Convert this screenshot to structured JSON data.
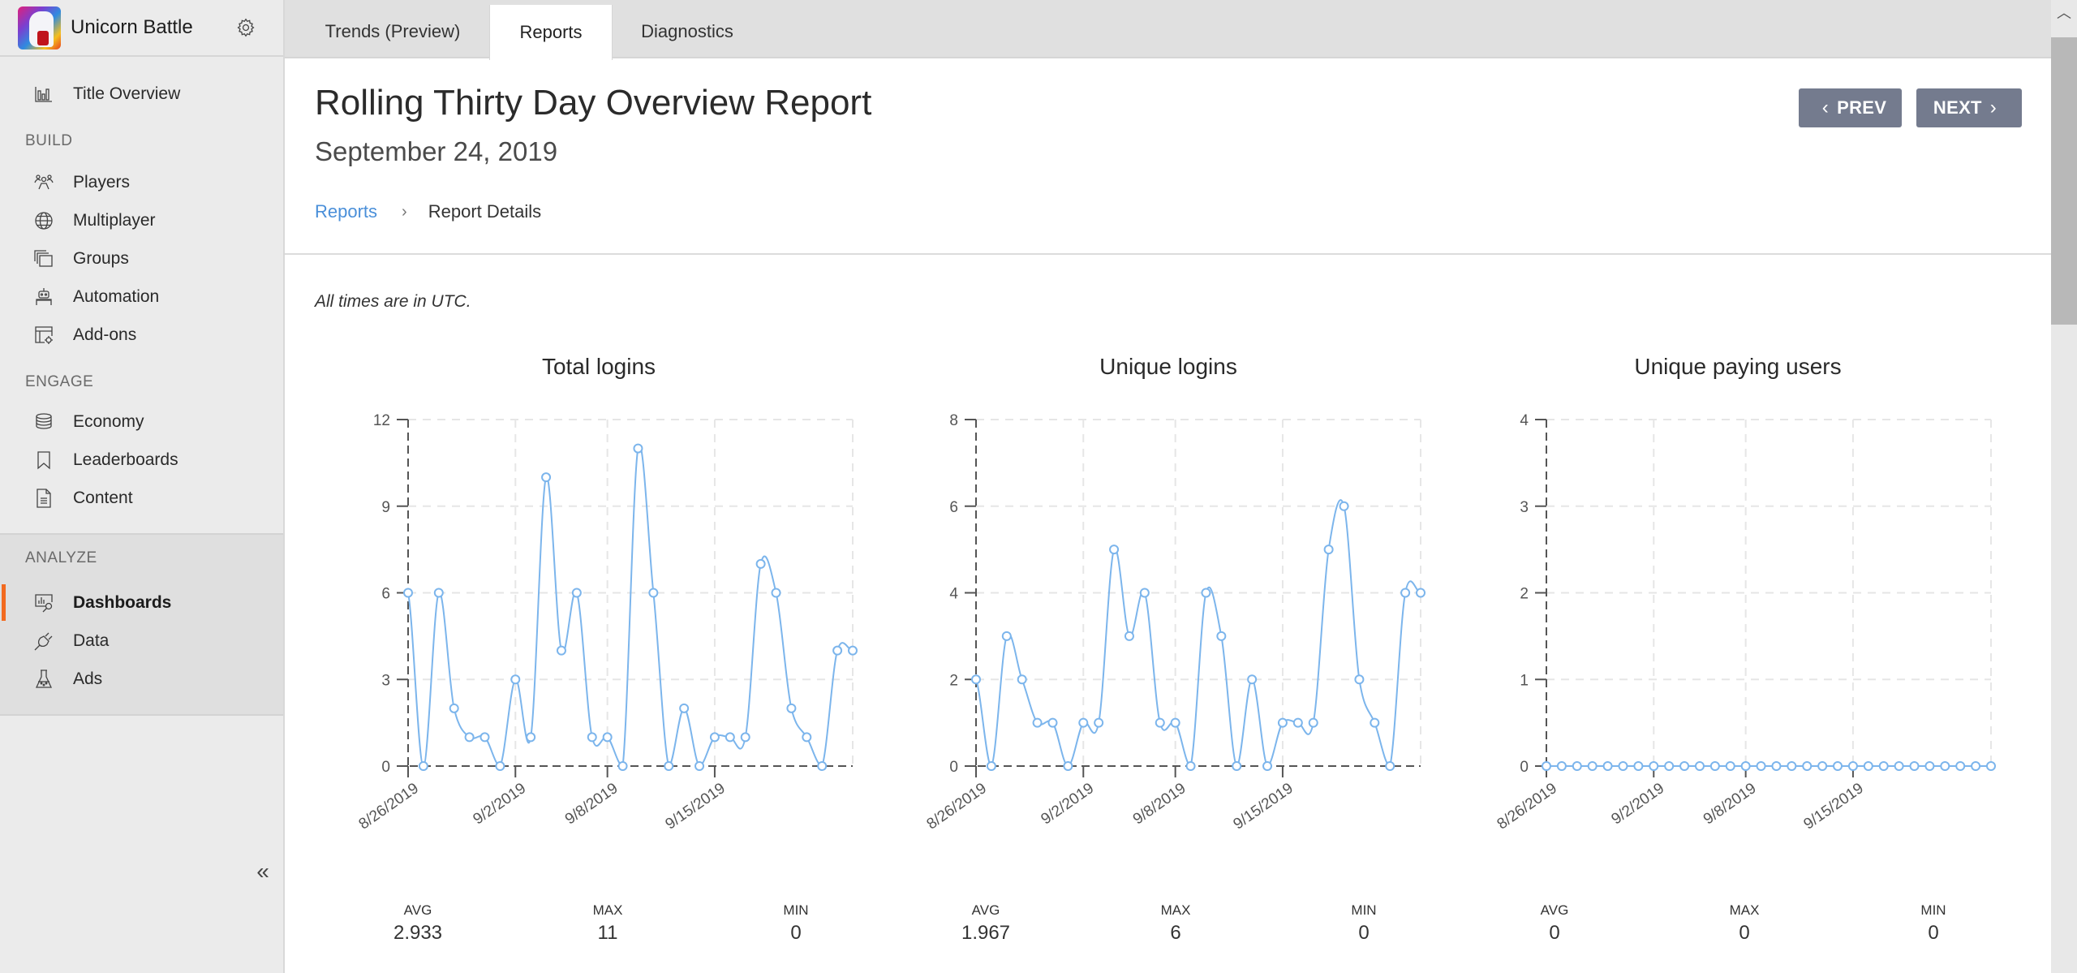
{
  "app": {
    "title": "Unicorn Battle",
    "logo_icon": "unicorn-logo",
    "settings_icon": "gear-icon"
  },
  "sidebar": {
    "top_item": {
      "label": "Title Overview",
      "icon": "bar-chart-icon"
    },
    "sections": [
      {
        "label": "BUILD",
        "items": [
          {
            "label": "Players",
            "icon": "players-icon"
          },
          {
            "label": "Multiplayer",
            "icon": "globe-icon"
          },
          {
            "label": "Groups",
            "icon": "groups-icon"
          },
          {
            "label": "Automation",
            "icon": "robot-icon"
          },
          {
            "label": "Add-ons",
            "icon": "addons-icon"
          }
        ]
      },
      {
        "label": "ENGAGE",
        "items": [
          {
            "label": "Economy",
            "icon": "coins-icon"
          },
          {
            "label": "Leaderboards",
            "icon": "bookmark-icon"
          },
          {
            "label": "Content",
            "icon": "document-icon"
          }
        ]
      },
      {
        "label": "ANALYZE",
        "items": [
          {
            "label": "Dashboards",
            "icon": "dashboard-icon",
            "active": true
          },
          {
            "label": "Data",
            "icon": "plug-icon"
          },
          {
            "label": "Ads",
            "icon": "flask-icon"
          }
        ]
      }
    ],
    "collapse_glyph": "«",
    "active_color": "#f26a1f"
  },
  "tabs": [
    {
      "label": "Trends (Preview)",
      "active": false
    },
    {
      "label": "Reports",
      "active": true
    },
    {
      "label": "Diagnostics",
      "active": false
    }
  ],
  "header": {
    "title": "Rolling Thirty Day Overview Report",
    "date": "September 24, 2019",
    "breadcrumb": [
      {
        "label": "Reports",
        "link": true
      },
      {
        "label": "Report Details",
        "link": false
      }
    ],
    "breadcrumb_sep": "›",
    "prev_label": "PREV",
    "next_label": "NEXT",
    "prev_glyph": "‹",
    "next_glyph": "›",
    "button_color": "#747b8e",
    "link_color": "#4a8fd9"
  },
  "note": "All times are in UTC.",
  "stats_labels": {
    "avg": "AVG",
    "max": "MAX",
    "min": "MIN"
  },
  "chart_data": [
    {
      "type": "line",
      "title": "Total logins",
      "xlabel": "",
      "ylabel": "",
      "x_start": "8/26/2019",
      "x_end": "9/24/2019",
      "x_ticks": [
        {
          "index": 0,
          "label": "8/26/2019"
        },
        {
          "index": 7,
          "label": "9/2/2019"
        },
        {
          "index": 13,
          "label": "9/8/2019"
        },
        {
          "index": 20,
          "label": "9/15/2019"
        }
      ],
      "y_ticks": [
        0,
        3,
        6,
        9,
        12
      ],
      "ylim": [
        0,
        12
      ],
      "grid": true,
      "color": "#7cb5ec",
      "values": [
        6,
        0,
        6,
        2,
        1,
        1,
        0,
        3,
        1,
        10,
        4,
        6,
        1,
        1,
        0,
        11,
        6,
        0,
        2,
        0,
        1,
        1,
        1,
        7,
        6,
        2,
        1,
        0,
        4,
        4
      ],
      "stats": {
        "avg": "2.933",
        "max": "11",
        "min": "0"
      }
    },
    {
      "type": "line",
      "title": "Unique logins",
      "xlabel": "",
      "ylabel": "",
      "x_start": "8/26/2019",
      "x_end": "9/24/2019",
      "x_ticks": [
        {
          "index": 0,
          "label": "8/26/2019"
        },
        {
          "index": 7,
          "label": "9/2/2019"
        },
        {
          "index": 13,
          "label": "9/8/2019"
        },
        {
          "index": 20,
          "label": "9/15/2019"
        }
      ],
      "y_ticks": [
        0,
        2,
        4,
        6,
        8
      ],
      "ylim": [
        0,
        8
      ],
      "grid": true,
      "color": "#7cb5ec",
      "values": [
        2,
        0,
        3,
        2,
        1,
        1,
        0,
        1,
        1,
        5,
        3,
        4,
        1,
        1,
        0,
        4,
        3,
        0,
        2,
        0,
        1,
        1,
        1,
        5,
        6,
        2,
        1,
        0,
        4,
        4
      ],
      "stats": {
        "avg": "1.967",
        "max": "6",
        "min": "0"
      }
    },
    {
      "type": "line",
      "title": "Unique paying users",
      "xlabel": "",
      "ylabel": "",
      "x_start": "8/26/2019",
      "x_end": "9/24/2019",
      "x_ticks": [
        {
          "index": 0,
          "label": "8/26/2019"
        },
        {
          "index": 7,
          "label": "9/2/2019"
        },
        {
          "index": 13,
          "label": "9/8/2019"
        },
        {
          "index": 20,
          "label": "9/15/2019"
        }
      ],
      "y_ticks": [
        0,
        1,
        2,
        3,
        4
      ],
      "ylim": [
        0,
        4
      ],
      "grid": true,
      "color": "#7cb5ec",
      "values": [
        0,
        0,
        0,
        0,
        0,
        0,
        0,
        0,
        0,
        0,
        0,
        0,
        0,
        0,
        0,
        0,
        0,
        0,
        0,
        0,
        0,
        0,
        0,
        0,
        0,
        0,
        0,
        0,
        0,
        0
      ],
      "stats": {
        "avg": "0",
        "max": "0",
        "min": "0"
      }
    }
  ]
}
